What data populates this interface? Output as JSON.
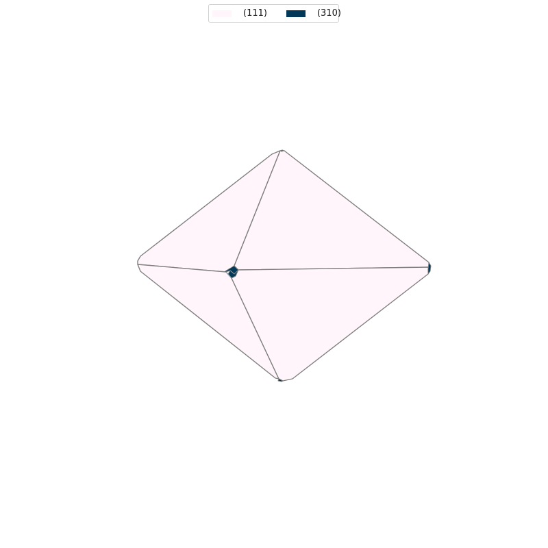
{
  "legend": {
    "entries": [
      {
        "label": "(111)",
        "color": "#fff5fa"
      },
      {
        "label": "(310)",
        "color": "#023858"
      }
    ]
  },
  "colors": {
    "facet_111": "#fff5fa",
    "facet_310": "#023858",
    "edge": "#808080"
  }
}
